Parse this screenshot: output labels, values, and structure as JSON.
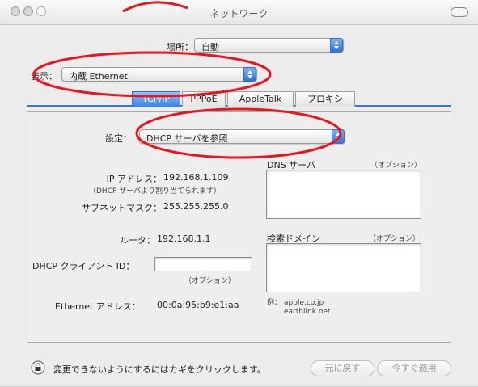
{
  "window": {
    "title": "ネットワーク"
  },
  "location": {
    "label": "場所：",
    "value": "自動"
  },
  "show": {
    "label": "表示：",
    "value": "内蔵 Ethernet"
  },
  "tabs": [
    {
      "label": "TCP/IP",
      "active": true
    },
    {
      "label": "PPPoE",
      "active": false
    },
    {
      "label": "AppleTalk",
      "active": false
    },
    {
      "label": "プロキシ",
      "active": false
    }
  ],
  "tcpip": {
    "config_label": "設定：",
    "config_value": "DHCP サーバを参照",
    "ip_label": "IP アドレス：",
    "ip_value": "192.168.1.109",
    "ip_note": "（DHCP サーバより割り当てられます）",
    "subnet_label": "サブネットマスク：",
    "subnet_value": "255.255.255.0",
    "router_label": "ルータ：",
    "router_value": "192.168.1.1",
    "dhcp_client_label": "DHCP クライアント ID：",
    "dhcp_client_value": "",
    "dhcp_client_note": "（オプション）",
    "ethernet_label": "Ethernet アドレス：",
    "ethernet_value": "00:0a:95:b9:e1:aa",
    "dns_label": "DNS サーバ",
    "dns_optional": "（オプション）",
    "dns_value": "",
    "search_label": "検索ドメイン",
    "search_optional": "（オプション）",
    "search_value": "",
    "example_label": "例：",
    "example_value1": "apple.co.jp",
    "example_value2": "earthlink.net"
  },
  "footer": {
    "lock_text": "変更できないようにするにはカギをクリックします。",
    "revert_label": "元に戻す",
    "apply_label": "今すぐ適用"
  },
  "colors": {
    "annotation": "#e8141e",
    "accent": "#3b77c8"
  }
}
